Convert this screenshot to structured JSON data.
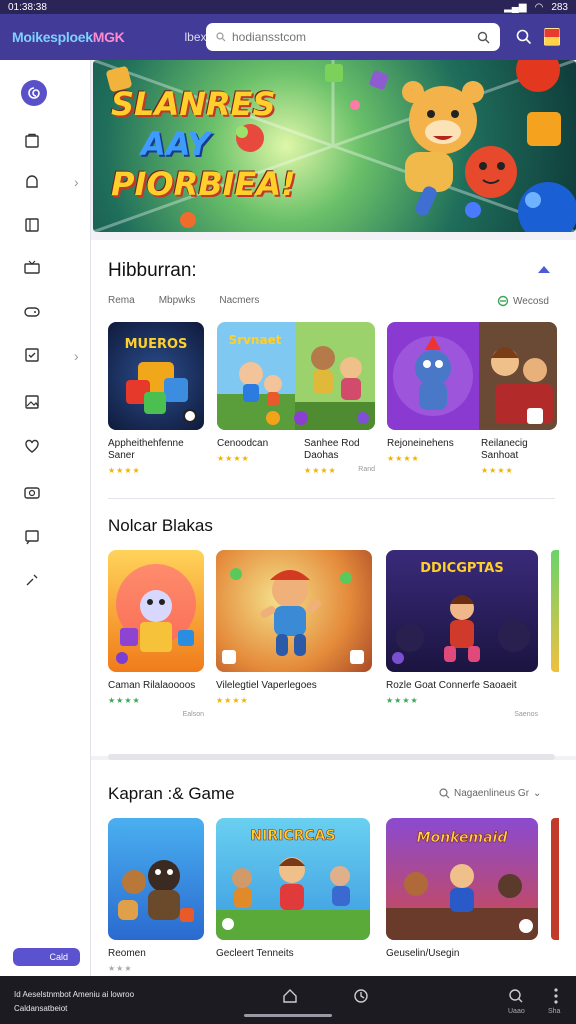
{
  "status": {
    "time": "01:38:38",
    "battery": "283"
  },
  "topbar": {
    "logo_a": "Moikesploek",
    "logo_b": "",
    "logo_c": "MGK",
    "nav_link": "lbex",
    "search_placeholder": "hodiansstcom"
  },
  "banner": {
    "line1": "SLANRES",
    "line2": "AAY",
    "line3": "PIORBIEA!"
  },
  "section1": {
    "title": "Hibburran:",
    "filters": [
      "Rema",
      "Mbpwks",
      "Nacmers"
    ],
    "more_label": "Wecosd",
    "cards": [
      {
        "title": "Appheithehfenne Saner",
        "rating": "★★★★",
        "sub": ""
      },
      {
        "title": "Cenoodcan",
        "rating": "★★★★",
        "sub": ""
      },
      {
        "title": "Sanhee Rod Daohas",
        "rating": "★★★★",
        "sub": "Rand"
      },
      {
        "title": "Rejoneinehens",
        "rating": "★★★★",
        "sub": ""
      },
      {
        "title": "Reilanecig Sanhoat",
        "rating": "★★★★",
        "sub": ""
      }
    ]
  },
  "section2": {
    "title": "Nolcar Blakas",
    "cards": [
      {
        "title": "Caman Rilalaoooos",
        "rating": "★★★★",
        "sub": "Ealson"
      },
      {
        "title": "Vilelegtiel Vaperlegoes",
        "rating": "★★★★",
        "sub": ""
      },
      {
        "title": "Rozle Goat Connerfe Saoaeit",
        "rating": "★★★★",
        "sub": "Saenos"
      }
    ],
    "thumb_labels": [
      "",
      "",
      "DDICGPTAS"
    ]
  },
  "section3": {
    "title": "Kapran :& Game",
    "more_label": "Nagaenlineus Gr",
    "cards": [
      {
        "title": "Reomen",
        "rating": "★★★"
      },
      {
        "title": "Gecleert Tenneits",
        "rating": ""
      },
      {
        "title": "Geuselin/Usegin",
        "rating": ""
      }
    ],
    "thumb_labels": [
      "",
      "NIRICRCAS",
      "Monkemaid"
    ]
  },
  "sidebar": {
    "pill_label": "Cald"
  },
  "bottombar": {
    "line1": "Id Aeselstnmbot Ameniu ai lowroo",
    "line2": "Caldansatbeiot",
    "nav": [
      "",
      "",
      "Uaao",
      "Sha"
    ]
  }
}
